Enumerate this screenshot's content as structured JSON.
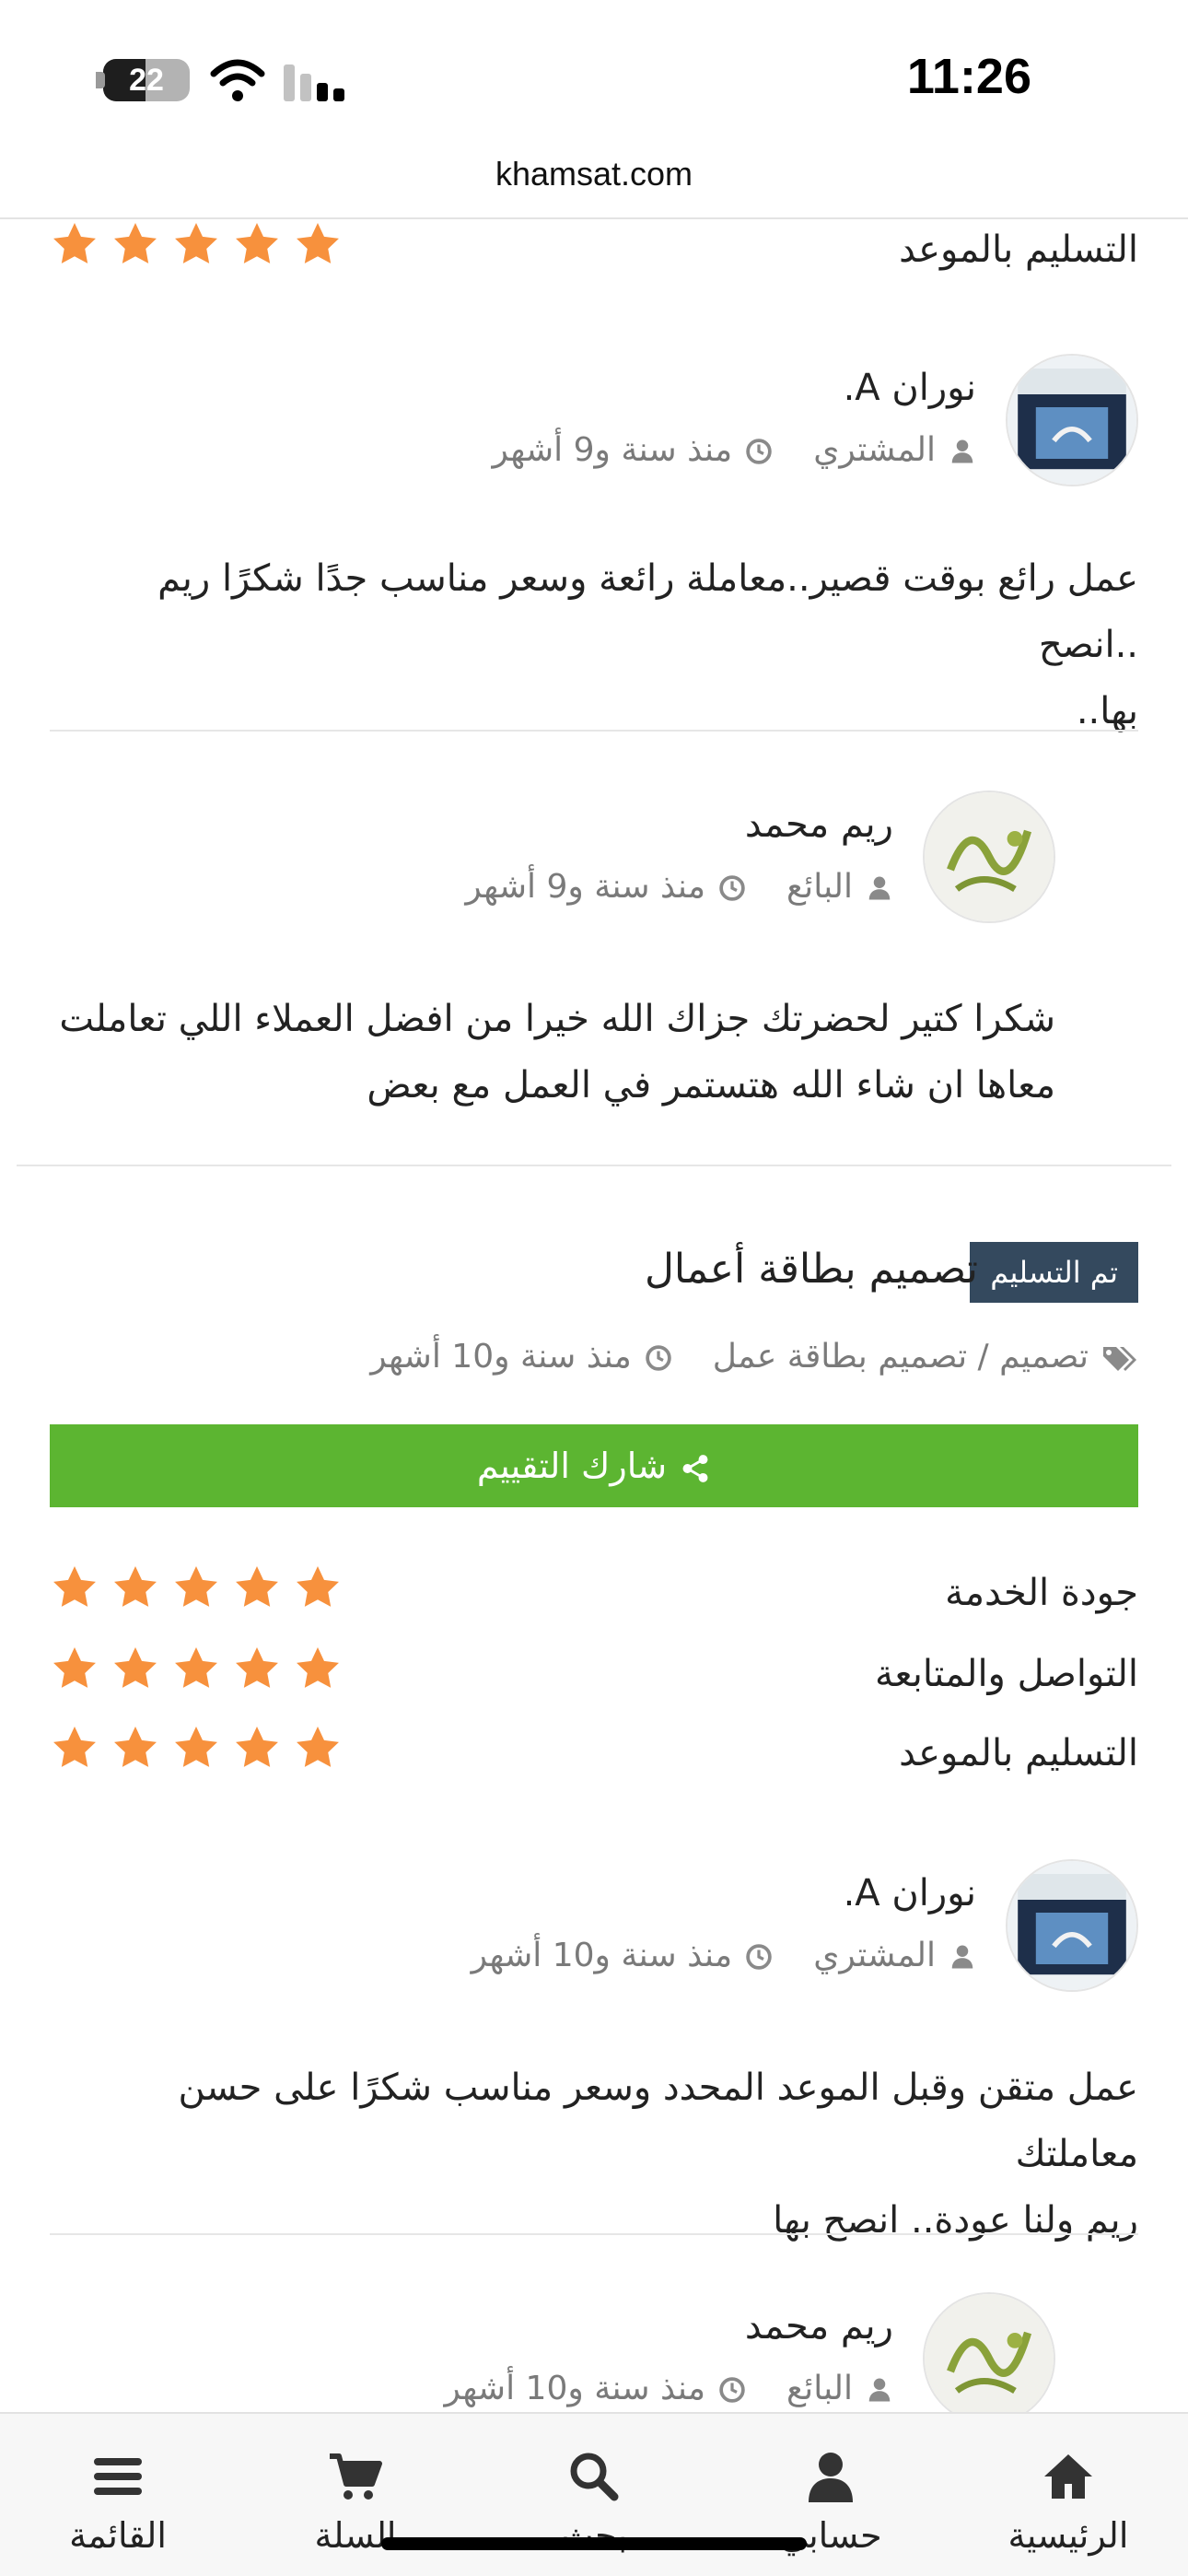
{
  "status_bar": {
    "time": "11:26",
    "battery_level": "22"
  },
  "browser": {
    "url": "khamsat.com"
  },
  "colors": {
    "star": "#f7913d",
    "share_button": "#5cb531",
    "badge": "#34495e",
    "meta_text": "#7a7a7a"
  },
  "top_section": {
    "rating_label": "التسليم بالموعد",
    "rating_stars": 5,
    "buyer_review": {
      "name": "نوران A.",
      "role": "المشتري",
      "time": "منذ سنة و9 أشهر",
      "text_line1": "عمل رائع بوقت قصير..معاملة رائعة وسعر مناسب جدًا شكرًا ريم ..انصح",
      "text_line2": "بها.."
    },
    "seller_reply": {
      "name": "ريم محمد",
      "role": "البائع",
      "time": "منذ سنة و9 أشهر",
      "text_line1": "شكرا كتير لحضرتك جزاك الله خيرا من افضل العملاء اللي تعاملت",
      "text_line2": "معاها ان شاء الله هتستمر في العمل مع بعض"
    }
  },
  "order": {
    "status_badge": "تم التسليم",
    "title": "تصميم بطاقة أعمال",
    "category": "تصميم / تصميم بطاقة عمل",
    "time": "منذ سنة و10 أشهر",
    "share_label": "شارك التقييم",
    "ratings": [
      {
        "label": "جودة الخدمة",
        "stars": 5
      },
      {
        "label": "التواصل والمتابعة",
        "stars": 5
      },
      {
        "label": "التسليم بالموعد",
        "stars": 5
      }
    ],
    "buyer_review": {
      "name": "نوران A.",
      "role": "المشتري",
      "time": "منذ سنة و10 أشهر",
      "text_line1": "عمل متقن وقبل الموعد المحدد وسعر مناسب شكرًا على حسن معاملتك",
      "text_line2": "ريم ولنا عودة.. انصح بها"
    },
    "seller_reply": {
      "name": "ريم محمد",
      "role": "البائع",
      "time": "منذ سنة و10 أشهر"
    }
  },
  "bottom_nav": {
    "home": "الرئيسية",
    "account": "حسابي",
    "search": "بحث",
    "cart": "السلة",
    "menu": "القائمة"
  }
}
